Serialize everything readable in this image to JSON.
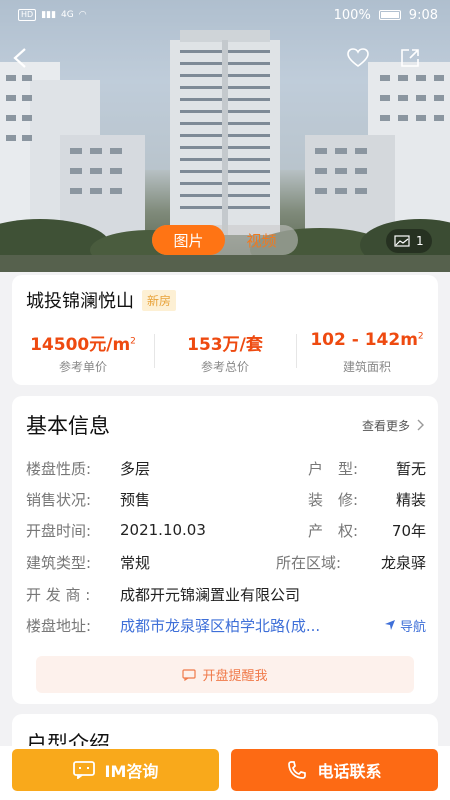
{
  "status_bar": {
    "battery": "100%",
    "time": "9:08",
    "network_left": "HD",
    "network_type": "4G"
  },
  "hero": {
    "tabs": [
      "图片",
      "视频"
    ],
    "active_tab": 0,
    "photo_count": "1"
  },
  "project": {
    "name": "城投锦澜悦山",
    "tag": "新房",
    "unit_price": "14500元/m",
    "unit_price_sup": "2",
    "unit_price_label": "参考单价",
    "total_price": "153万/套",
    "total_price_label": "参考总价",
    "area": "102 - 142m",
    "area_sup": "2",
    "area_label": "建筑面积"
  },
  "basic_info": {
    "title": "基本信息",
    "more": "查看更多",
    "rows": [
      {
        "label": "楼盘性质:",
        "value": "多层",
        "right_label": "户　型:",
        "right_value": "暂无"
      },
      {
        "label": "销售状况:",
        "value": "预售",
        "right_label": "装　修:",
        "right_value": "精装"
      },
      {
        "label": "开盘时间:",
        "value": "2021.10.03",
        "right_label": "产　权:",
        "right_value": "70年"
      },
      {
        "label": "建筑类型:",
        "value": "常规",
        "right_label": "所在区域:",
        "right_value": "龙泉驿"
      }
    ],
    "developer_label": "开 发 商 :",
    "developer": "成都开元锦澜置业有限公司",
    "address_label": "楼盘地址:",
    "address": "成都市龙泉驿区柏学北路(成...",
    "nav": "导航",
    "remind": "开盘提醒我"
  },
  "next_section": {
    "title": "户型介绍"
  },
  "bottom_bar": {
    "im": "IM咨询",
    "call": "电话联系"
  },
  "colors": {
    "accent": "#fd6a14",
    "im": "#f9a91b",
    "price": "#ee4a10",
    "link": "#3e6fd8"
  }
}
